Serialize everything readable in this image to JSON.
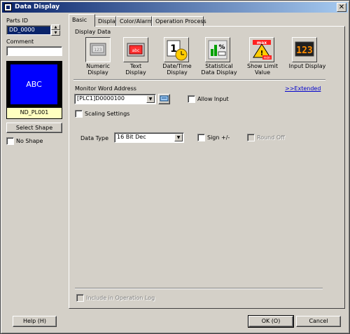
{
  "window": {
    "title": "Data Display",
    "close_glyph": "✕"
  },
  "left": {
    "parts_id_label": "Parts ID",
    "parts_id_value": "DD_0000",
    "comment_label": "Comment",
    "comment_value": "",
    "preview_text": "ABC",
    "shape_name": "ND_PL001",
    "select_shape": "Select Shape",
    "no_shape": "No Shape"
  },
  "tabs": [
    {
      "label": "Basic"
    },
    {
      "label": "Display"
    },
    {
      "label": "Color/Alarm"
    },
    {
      "label": "Operation Process"
    }
  ],
  "display_data": {
    "heading": "Display Data",
    "items": [
      {
        "label": "Numeric\nDisplay",
        "icon": "numeric-display-icon"
      },
      {
        "label": "Text\nDisplay",
        "icon": "text-display-icon"
      },
      {
        "label": "Date/Time\nDisplay",
        "icon": "date-time-icon"
      },
      {
        "label": "Statistical\nData Display",
        "icon": "statistical-icon"
      },
      {
        "label": "Show Limit\nValue",
        "icon": "limit-value-icon"
      },
      {
        "label": "Input Display",
        "icon": "input-display-icon"
      }
    ]
  },
  "monitor": {
    "label": "Monitor Word Address",
    "extended": ">>Extended",
    "address": "[PLC1]D0000100",
    "allow_input": "Allow Input",
    "scaling": "Scaling Settings"
  },
  "data_type": {
    "label": "Data Type",
    "value": "16 Bit Dec",
    "sign": "Sign +/-",
    "round_off": "Round Off"
  },
  "oplog": "Include in Operation Log",
  "footer": {
    "help": "Help (H)",
    "ok": "OK (O)",
    "cancel": "Cancel"
  },
  "colors": {
    "title_start": "#0a246a",
    "title_end": "#a6caf0",
    "preview_bg": "#0000ff",
    "shape_label_bg": "#ffffc0"
  }
}
